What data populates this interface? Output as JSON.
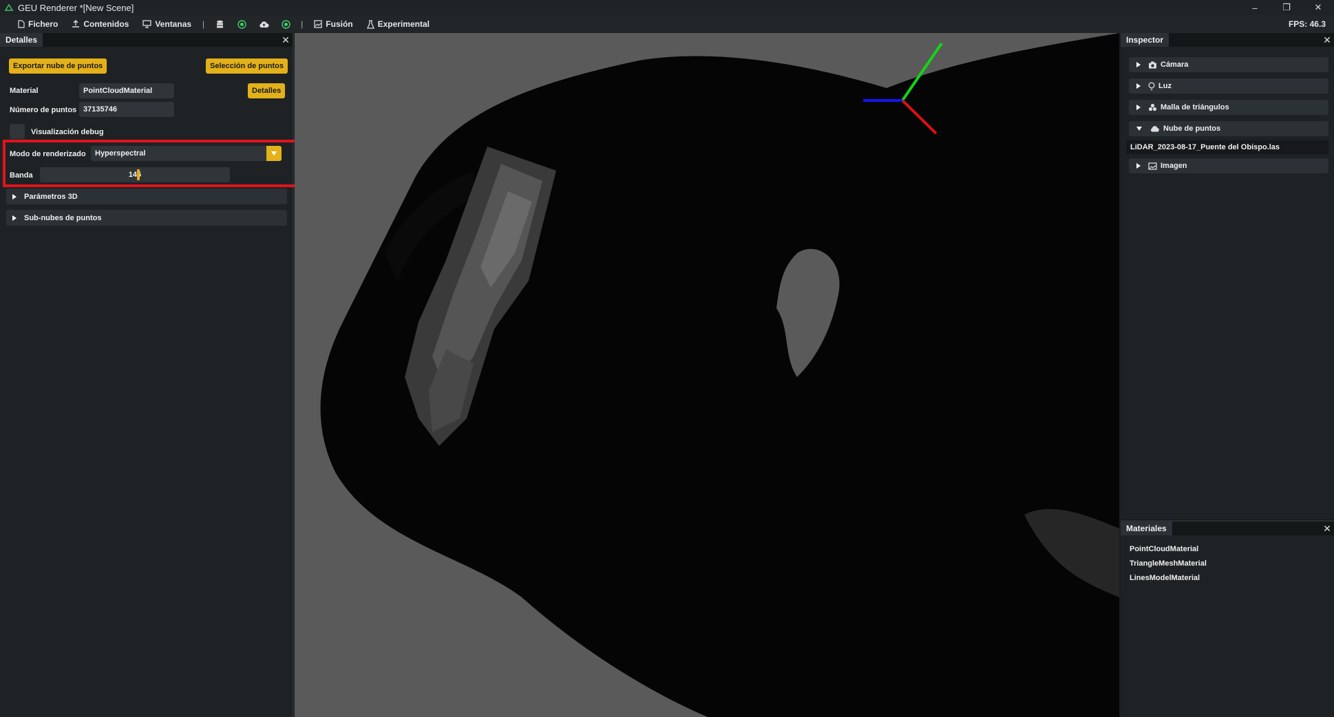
{
  "window": {
    "title": "GEU Renderer *[New Scene]",
    "controls": [
      "minimize-icon",
      "restore-icon",
      "close-icon"
    ]
  },
  "menubar": {
    "items": [
      "Fichero",
      "Contenidos",
      "Ventanas"
    ],
    "separator": "|",
    "items2": [
      "Fusión",
      "Experimental"
    ],
    "fps": "FPS: 46.3"
  },
  "details": {
    "tab": "Detalles",
    "export_button": "Exportar nube de puntos",
    "selection_button": "Selección de puntos",
    "material_label": "Material",
    "material_value": "PointCloudMaterial",
    "details_button": "Detalles",
    "points_label": "Número de puntos",
    "points_value": "37135746",
    "debug_label": "Visualización debug",
    "render_mode_label": "Modo de renderizado",
    "render_mode_value": "Hyperspectral",
    "band_label": "Banda",
    "band_value": "145",
    "band_fraction": 0.52,
    "section_3d": "Parámetros 3D",
    "section_subclouds": "Sub-nubes de puntos"
  },
  "inspector": {
    "tab": "Inspector",
    "items": [
      {
        "label": "Cámara",
        "icon": "camera-icon"
      },
      {
        "label": "Luz",
        "icon": "lightbulb-icon"
      },
      {
        "label": "Malla de triángulos",
        "icon": "mesh-icon"
      },
      {
        "label": "Nube de puntos",
        "icon": "cloud-icon"
      }
    ],
    "pointcloud_child": "LiDAR_2023-08-17_Puente del Obispo.las",
    "image_item": "Imagen"
  },
  "materials": {
    "tab": "Materiales",
    "items": [
      "PointCloudMaterial",
      "TriangleMeshMaterial",
      "LinesModelMaterial"
    ]
  },
  "colors": {
    "accent": "#e3b11a",
    "highlight": "#e3121b",
    "viewport_bg": "#5a5a5a",
    "axis_x": "#e01010",
    "axis_y": "#12d612",
    "axis_z": "#1414f0"
  }
}
